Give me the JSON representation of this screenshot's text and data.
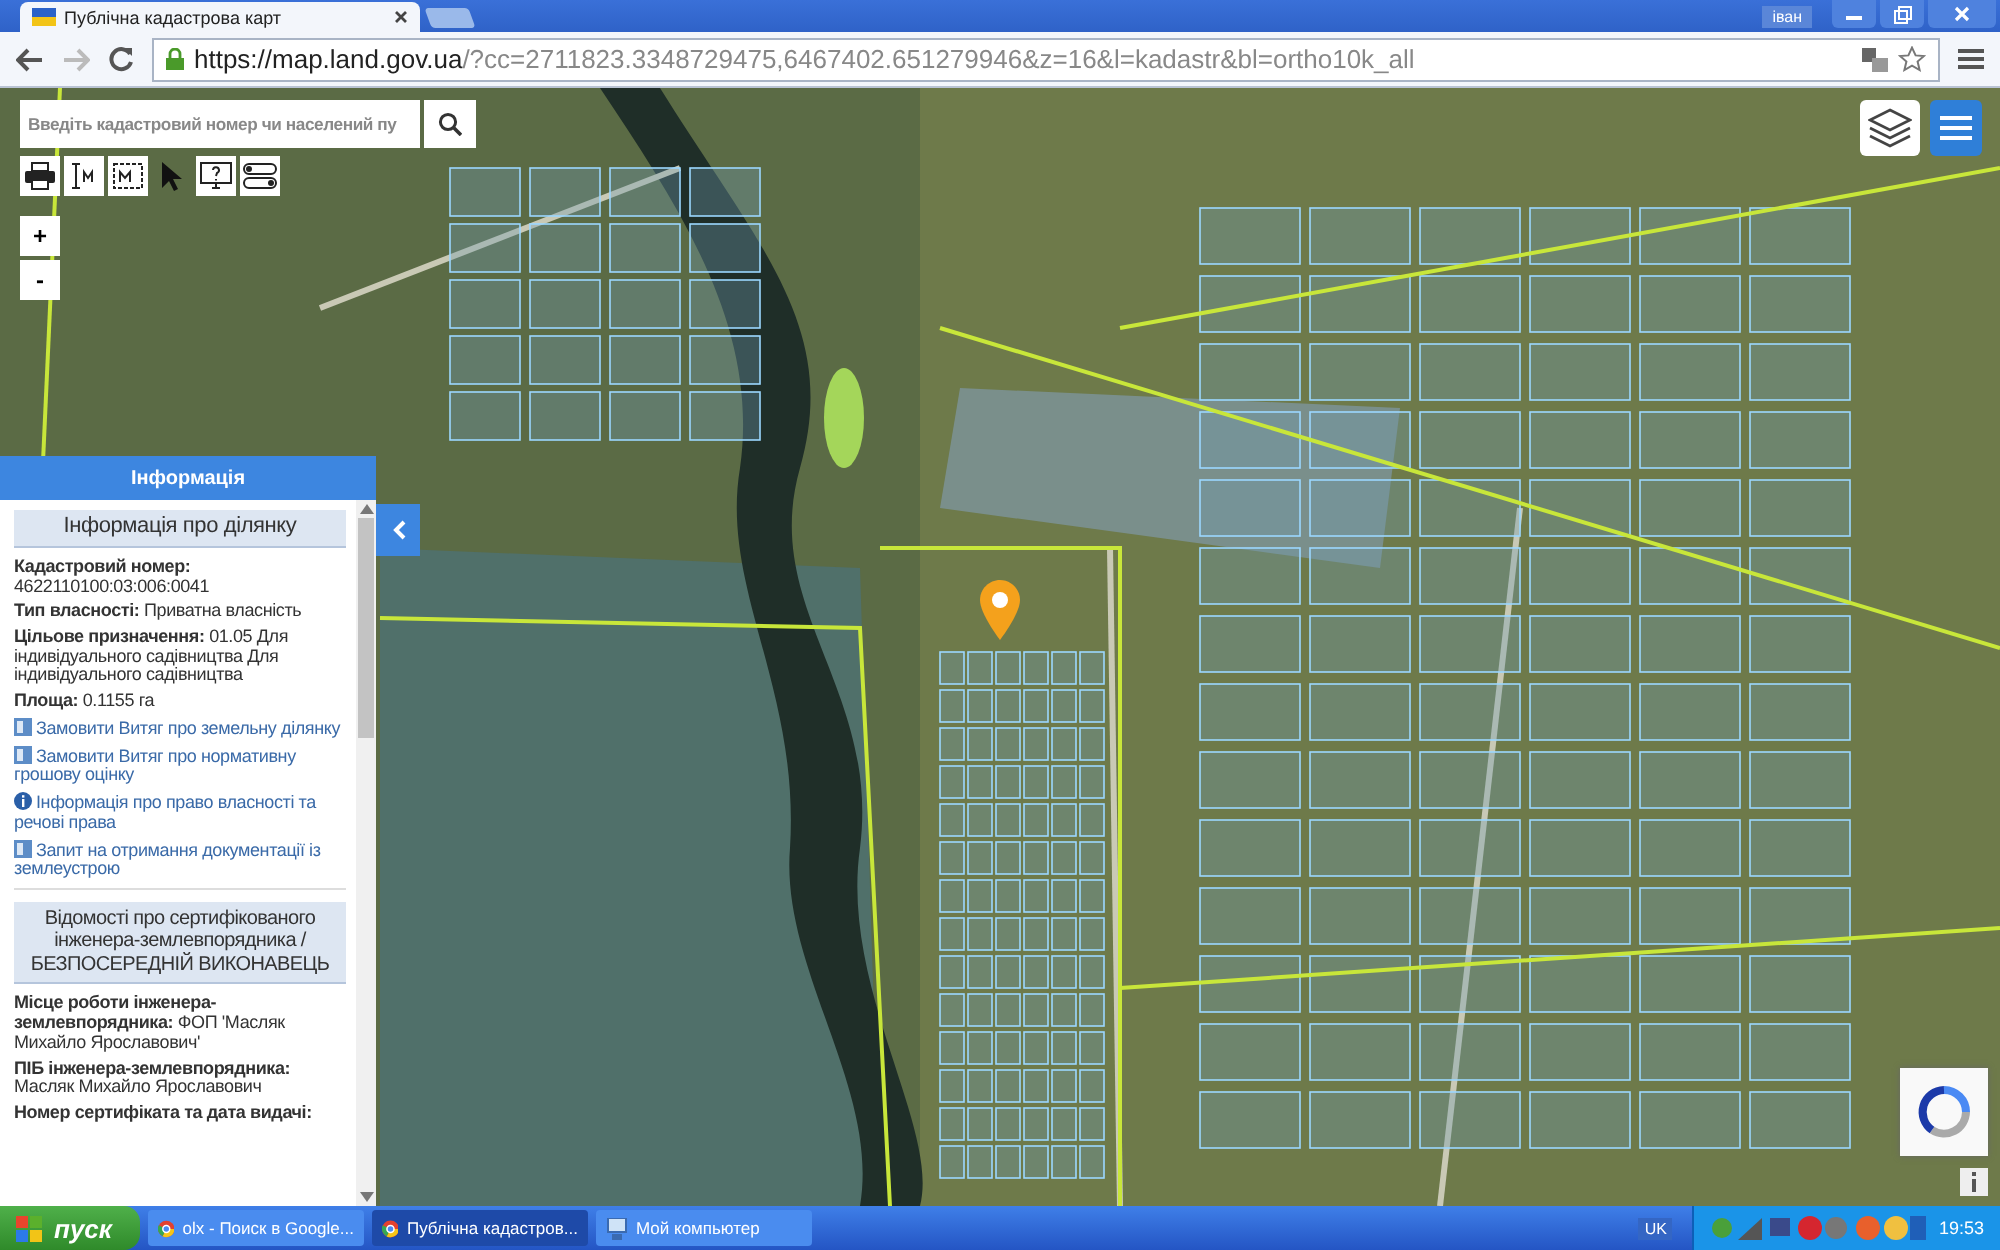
{
  "browser": {
    "tabs": [
      {
        "title": "Публічна кадастрова карт",
        "selected": true
      }
    ],
    "user": "іван",
    "url_host": "https://map.land.gov.ua",
    "url_path": "/?cc=2711823.3348729475,6467402.651279946&z=16&l=kadastr&bl=ortho10k_all"
  },
  "map": {
    "search": {
      "placeholder": "Введіть кадастровий номер чи населений пу"
    },
    "zoom_in": "+",
    "zoom_out": "-"
  },
  "info_panel": {
    "header": "Інформація",
    "section_title": "Інформація про ділянку",
    "fields": [
      {
        "label": "Кадастровий номер:",
        "value": "4622110100:03:006:0041"
      },
      {
        "label": "Тип власності:",
        "value": "Приватна власність"
      },
      {
        "label": "Цільове призначення:",
        "value": "01.05 Для індивідуального садівництва Для індивідуального садівництва"
      },
      {
        "label": "Площа:",
        "value": "0.1155 га"
      }
    ],
    "links": [
      {
        "kind": "document",
        "text": "Замовити Витяг про земельну ділянку"
      },
      {
        "kind": "document",
        "text": "Замовити Витяг про нормативну грошову оцінку"
      },
      {
        "kind": "info",
        "text": "Інформація про право власності та речові права"
      },
      {
        "kind": "document",
        "text": "Запит на отримання документації із землеустрою"
      }
    ],
    "engineer_title": "Відомості про сертифікованого інженера-землевпорядника / БЕЗПОСЕРЕДНІЙ ВИКОНАВЕЦЬ",
    "engineer_fields": [
      {
        "label": "Місце роботи інженера-землевпорядника:",
        "value": "ФОП 'Масляк Михайло Ярославович'"
      },
      {
        "label": "ПІБ інженера-землевпорядника:",
        "value": "Масляк Михайло Ярославович"
      },
      {
        "label": "Номер сертифіката та дата видачі:"
      }
    ]
  },
  "taskbar": {
    "start": "пуск",
    "tasks": [
      {
        "title": "olx - Поиск в Google...",
        "selected": false,
        "kind": "browser"
      },
      {
        "title": "Публічна кадастров...",
        "selected": true,
        "kind": "browser"
      },
      {
        "title": "Мой компьютер",
        "selected": false,
        "kind": "computer"
      }
    ],
    "language": "UK",
    "clock": "19:53"
  }
}
